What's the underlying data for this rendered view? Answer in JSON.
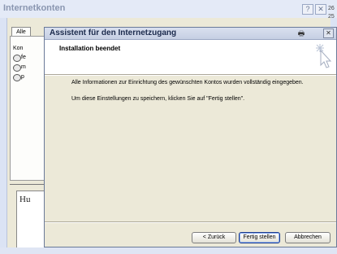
{
  "outer": {
    "title": "Internetkonten",
    "help_glyph": "?",
    "close_glyph": "✕",
    "side_numbers": [
      "26",
      "25"
    ],
    "tab_label": "Alle",
    "panel_header": "Kon",
    "rows": [
      {
        "text": "fe"
      },
      {
        "text": "m"
      },
      {
        "text": "p"
      }
    ],
    "doc_text": "Hu"
  },
  "wizard": {
    "title": "Assistent für den Internetzugang",
    "print_glyph": "🖶",
    "close_glyph": "✕",
    "header_title": "Installation beendet",
    "message1": "Alle Informationen zur Einrichtung des gewünschten Kontos wurden vollständig eingegeben.",
    "message2": "Um diese Einstellungen zu speichern, klicken Sie auf \"Fertig stellen\".",
    "buttons": {
      "back": "< Zurück",
      "finish": "Fertig stellen",
      "cancel": "Abbrechen"
    }
  }
}
